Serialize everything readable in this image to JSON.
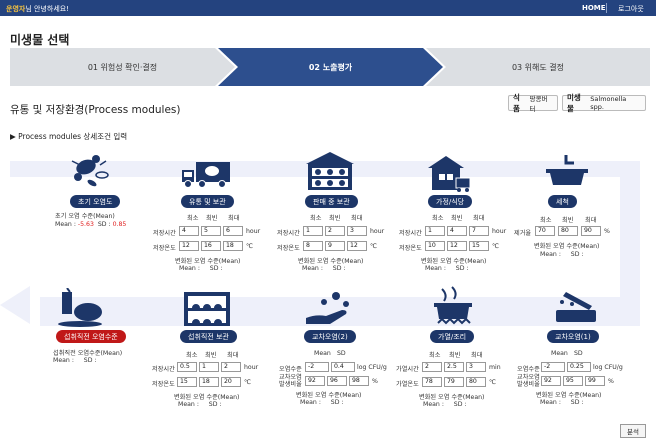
{
  "topbar": {
    "greet_name": "운영자",
    "greet_suffix": "님 안녕하세요!",
    "home": "HOME",
    "logout": "로그아웃"
  },
  "page_title": "미생물 선택",
  "steps": [
    "01 위험성 확인·결정",
    "02 노출평가",
    "03 위해도 결정"
  ],
  "section_title": "유통 및 저장환경(Process modules)",
  "tags": [
    {
      "k": "식품",
      "v": "땅콩버터"
    },
    {
      "k": "미생물",
      "v": "Salmonella spp."
    }
  ],
  "subhead": "▶ Process modules 상세조건 입력",
  "col": {
    "min": "최소",
    "mode": "최빈",
    "max": "최대"
  },
  "n1": {
    "label": "초기 오염도",
    "line1": "초기 오염 수준(Mean)",
    "mean_label": "Mean :",
    "mean": "-5.63",
    "sd_label": "SD :",
    "sd": "0.85"
  },
  "n2": {
    "label": "유통 및 보관",
    "r1": "저장시간",
    "r1v": [
      "4",
      "5",
      "6"
    ],
    "r1u": "hour",
    "r2": "저장온도",
    "r2v": [
      "12",
      "16",
      "18"
    ],
    "r2u": "℃",
    "chg": "변화된 오염 수준(Mean)",
    "mean": "Mean :",
    "sd": "SD :"
  },
  "n3": {
    "label": "판매 중 보관",
    "r1": "저장시간",
    "r1v": [
      "1",
      "2",
      "3"
    ],
    "r1u": "hour",
    "r2": "저장온도",
    "r2v": [
      "8",
      "9",
      "12"
    ],
    "r2u": "℃",
    "chg": "변화된 오염 수준(Mean)",
    "mean": "Mean :",
    "sd": "SD :"
  },
  "n4": {
    "label": "가정/식당",
    "r1": "저장시간",
    "r1v": [
      "1",
      "4",
      "7"
    ],
    "r1u": "hour",
    "r2": "저장온도",
    "r2v": [
      "10",
      "12",
      "15"
    ],
    "r2u": "℃",
    "chg": "변화된 오염 수준(Mean)",
    "mean": "Mean :",
    "sd": "SD :"
  },
  "n5": {
    "label": "세척",
    "r1": "제거율",
    "r1v": [
      "70",
      "80",
      "90"
    ],
    "r1u": "%",
    "chg": "변화된 오염 수준(Mean)",
    "mean": "Mean :",
    "sd": "SD :"
  },
  "n6": {
    "label": "섭취직전 오염수준",
    "line1": "섭취직전 오염수준(Mean)",
    "mean": "Mean :",
    "sd": "SD :"
  },
  "n7": {
    "label": "섭취직전 보관",
    "r1": "저장시간",
    "r1v": [
      "0.5",
      "1",
      "2"
    ],
    "r1u": "hour",
    "r2": "저장온도",
    "r2v": [
      "15",
      "18",
      "20"
    ],
    "r2u": "℃",
    "chg": "변화된 오염 수준(Mean)",
    "mean": "Mean :",
    "sd": "SD :"
  },
  "n8": {
    "label": "교차오염(2)",
    "hdr": [
      "Mean",
      "SD"
    ],
    "r1": "오염수준",
    "r1v": [
      "-2",
      "0.4"
    ],
    "r1u": "log CFU/g",
    "r2a": "교차오염",
    "r2b": "발생비율",
    "r2v": [
      "92",
      "96",
      "98"
    ],
    "r2u": "%",
    "chg": "변화된 오염 수준(Mean)",
    "mean": "Mean :",
    "sd": "SD :"
  },
  "n9": {
    "label": "가열/조리",
    "r1": "가열시간",
    "r1v": [
      "2",
      "2.5",
      "3"
    ],
    "r1u": "min",
    "r2": "가열온도",
    "r2v": [
      "78",
      "79",
      "80"
    ],
    "r2u": "℃",
    "chg": "변화된 오염 수준(Mean)",
    "mean": "Mean :",
    "sd": "SD :"
  },
  "n10": {
    "label": "교차오염(1)",
    "hdr": [
      "Mean",
      "SD"
    ],
    "r1": "오염수준",
    "r1v": [
      "-2",
      "0.25"
    ],
    "r1u": "log CFU/g",
    "r2a": "교차오염",
    "r2b": "발생비율",
    "r2v": [
      "92",
      "95",
      "99"
    ],
    "r2u": "%",
    "chg": "변화된 오염 수준(Mean)",
    "mean": "Mean :",
    "sd": "SD :"
  },
  "analyze": "분석",
  "colors": {
    "navy": "#1d3668",
    "header": "#24437f",
    "active_step": "#2d4f8e",
    "flow": "#eef0fa",
    "red": "#c01818"
  }
}
